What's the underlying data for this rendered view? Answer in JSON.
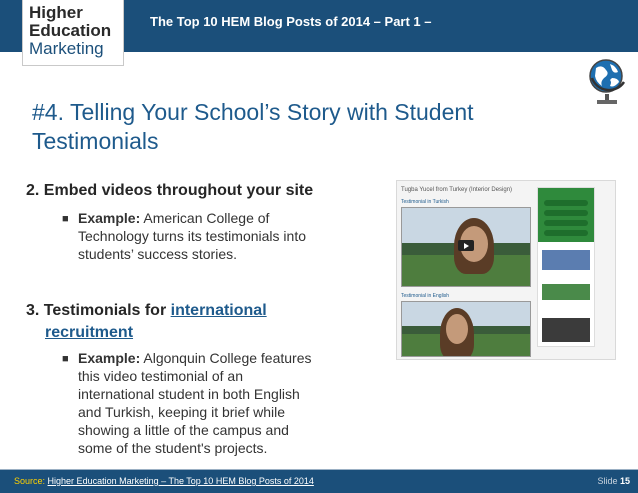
{
  "header": {
    "logo": {
      "line1": "Higher",
      "line2": "Education",
      "line3": "Marketing"
    },
    "title": "The Top 10 HEM Blog Posts of 2014 – Part 1 –"
  },
  "slide": {
    "title_line1": "#4. Telling Your School’s Story with Student",
    "title_line2": "Testimonials",
    "section1": {
      "heading": "2. Embed videos throughout your site",
      "bullet_lead": "Example:",
      "bullet_lines": [
        "American College of",
        "Technology turns its testimonials into",
        "students’ success stories."
      ]
    },
    "section2": {
      "heading_prefix": "3. Testimonials for ",
      "heading_link": "international",
      "heading_line2": "recruitment",
      "bullet_lead": "Example:",
      "bullet_lines": [
        "Algonquin College features",
        "this video testimonial of an",
        "international student in both English",
        "and Turkish, keeping it brief while",
        "showing a little of the campus and",
        "some of the student's projects."
      ]
    }
  },
  "screenshot": {
    "heading": "Tugba Yucel from Turkey (Interior Design)",
    "label_turkish": "Testimonial in Turkish",
    "label_english": "Testimonial in English"
  },
  "footer": {
    "source_label": "Source:",
    "source_link": "Higher Education Marketing – The Top 10 HEM Blog Posts of 2014",
    "slide_label": "Slide",
    "slide_number": "15"
  },
  "colors": {
    "brand_blue": "#1b4f7a",
    "title_blue": "#1e5a8c",
    "source_yellow": "#ffd100"
  },
  "icons": {
    "globe": "globe-on-stand-icon",
    "bullet": "square-bullet-icon",
    "play": "play-icon"
  }
}
